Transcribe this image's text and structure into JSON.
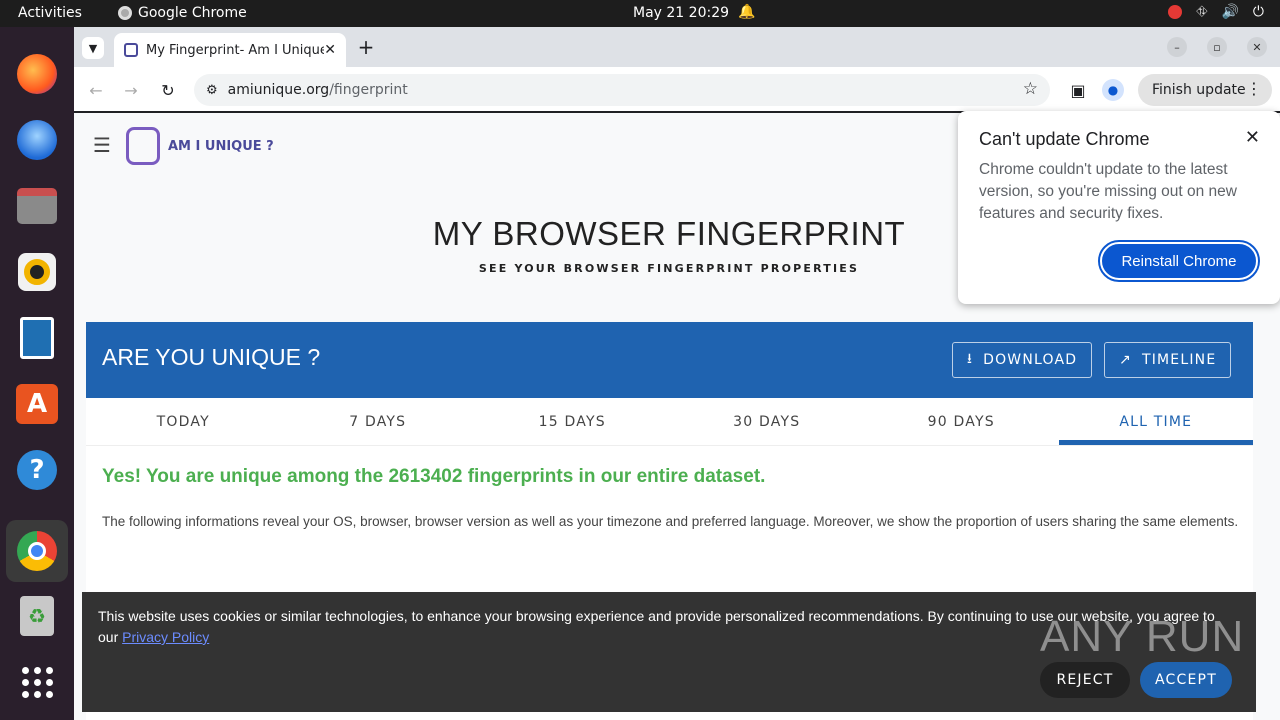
{
  "topbar": {
    "activities": "Activities",
    "app_name": "Google Chrome",
    "datetime": "May 21  20:29"
  },
  "browser": {
    "tab_title": "My Fingerprint- Am I Unique?",
    "url_host": "amiunique.org",
    "url_path": "/fingerprint",
    "finish_update": "Finish update"
  },
  "site": {
    "logo_text": "AM I UNIQUE ?",
    "title": "MY BROWSER FINGERPRINT",
    "subtitle": "SEE YOUR BROWSER FINGERPRINT PROPERTIES",
    "card_title": "ARE YOU UNIQUE ?",
    "download_label": "DOWNLOAD",
    "timeline_label": "TIMELINE",
    "tabs": [
      "TODAY",
      "7 DAYS",
      "15 DAYS",
      "30 DAYS",
      "90 DAYS",
      "ALL TIME"
    ],
    "active_tab": "ALL TIME",
    "unique_message": "Yes! You are unique among the 2613402 fingerprints in our entire dataset.",
    "description": "The following informations reveal your OS, browser, browser version as well as your timezone and preferred language. Moreover, we show the proportion of users sharing the same elements."
  },
  "popup": {
    "title": "Can't update Chrome",
    "message": "Chrome couldn't update to the latest version, so you're missing out on new features and security fixes.",
    "button": "Reinstall Chrome"
  },
  "cookie": {
    "text": "This website uses cookies or similar technologies, to enhance your browsing experience and provide personalized recommendations. By continuing to use our website, you agree to our ",
    "link": "Privacy Policy",
    "reject": "REJECT",
    "accept": "ACCEPT"
  },
  "watermark": "ANY RUN",
  "colors": {
    "brand_blue": "#1f63b0",
    "success_green": "#4caf50",
    "chrome_blue": "#0b57d0"
  }
}
